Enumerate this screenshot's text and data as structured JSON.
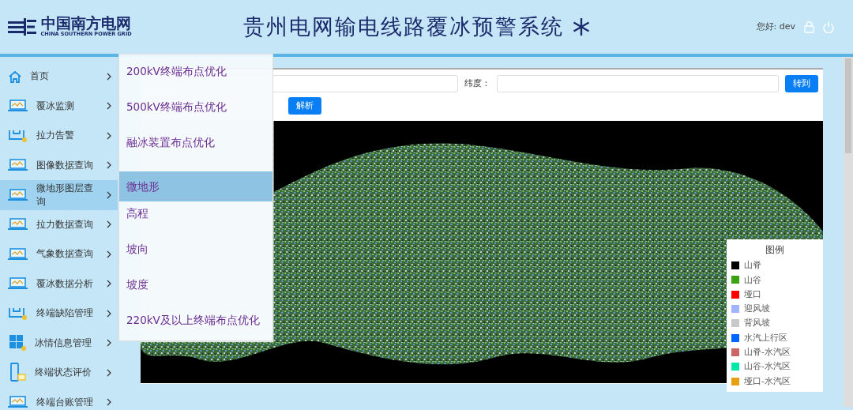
{
  "header": {
    "logo_cn": "中国南方电网",
    "logo_en": "CHINA SOUTHERN POWER GRID",
    "title": "贵州电网输电线路覆冰预警系统",
    "greeting": "您好: dev"
  },
  "sidebar": {
    "items": [
      {
        "label": "首页",
        "kind": "home",
        "selected": false
      },
      {
        "label": "覆冰监测",
        "kind": "laptop",
        "selected": false
      },
      {
        "label": "拉力告警",
        "kind": "tray",
        "selected": false
      },
      {
        "label": "图像数据查询",
        "kind": "laptop",
        "selected": false
      },
      {
        "label": "微地形图层查询",
        "kind": "laptop",
        "selected": true
      },
      {
        "label": "拉力数据查询",
        "kind": "laptop",
        "selected": false
      },
      {
        "label": "气象数据查询",
        "kind": "laptop",
        "selected": false
      },
      {
        "label": "覆冰数据分析",
        "kind": "laptop",
        "selected": false
      },
      {
        "label": "终端缺陷管理",
        "kind": "tray",
        "selected": false
      },
      {
        "label": "冰情信息管理",
        "kind": "cubes",
        "selected": false
      },
      {
        "label": "终端状态评价",
        "kind": "device",
        "selected": false
      },
      {
        "label": "终端台账管理",
        "kind": "laptop",
        "selected": false
      }
    ]
  },
  "submenu": {
    "items": [
      {
        "label": "200kV终端布点优化",
        "selected": false
      },
      {
        "label": "500kV终端布点优化",
        "selected": false
      },
      {
        "label": "融冰装置布点优化",
        "selected": false
      },
      {
        "label": "微地形",
        "selected": true
      },
      {
        "label": "高程",
        "selected": false
      },
      {
        "label": "坡向",
        "selected": false
      },
      {
        "label": "坡度",
        "selected": false
      },
      {
        "label": "220kV及以上终端布点优化",
        "selected": false
      }
    ]
  },
  "form": {
    "lat_label": "纬度：",
    "goto_button": "转到",
    "parse_button": "解析"
  },
  "legend": {
    "title": "图例",
    "items": [
      {
        "label": "山脊",
        "color": "#000000"
      },
      {
        "label": "山谷",
        "color": "#3aa30f"
      },
      {
        "label": "垭口",
        "color": "#ff0000"
      },
      {
        "label": "迎风坡",
        "color": "#a0b4ff"
      },
      {
        "label": "背风坡",
        "color": "#c8c8c8"
      },
      {
        "label": "水汽上行区",
        "color": "#0066ff"
      },
      {
        "label": "山脊-水汽区",
        "color": "#cc6666"
      },
      {
        "label": "山谷-水汽区",
        "color": "#00e8a8"
      },
      {
        "label": "垭口-水汽区",
        "color": "#e8a010"
      }
    ]
  }
}
